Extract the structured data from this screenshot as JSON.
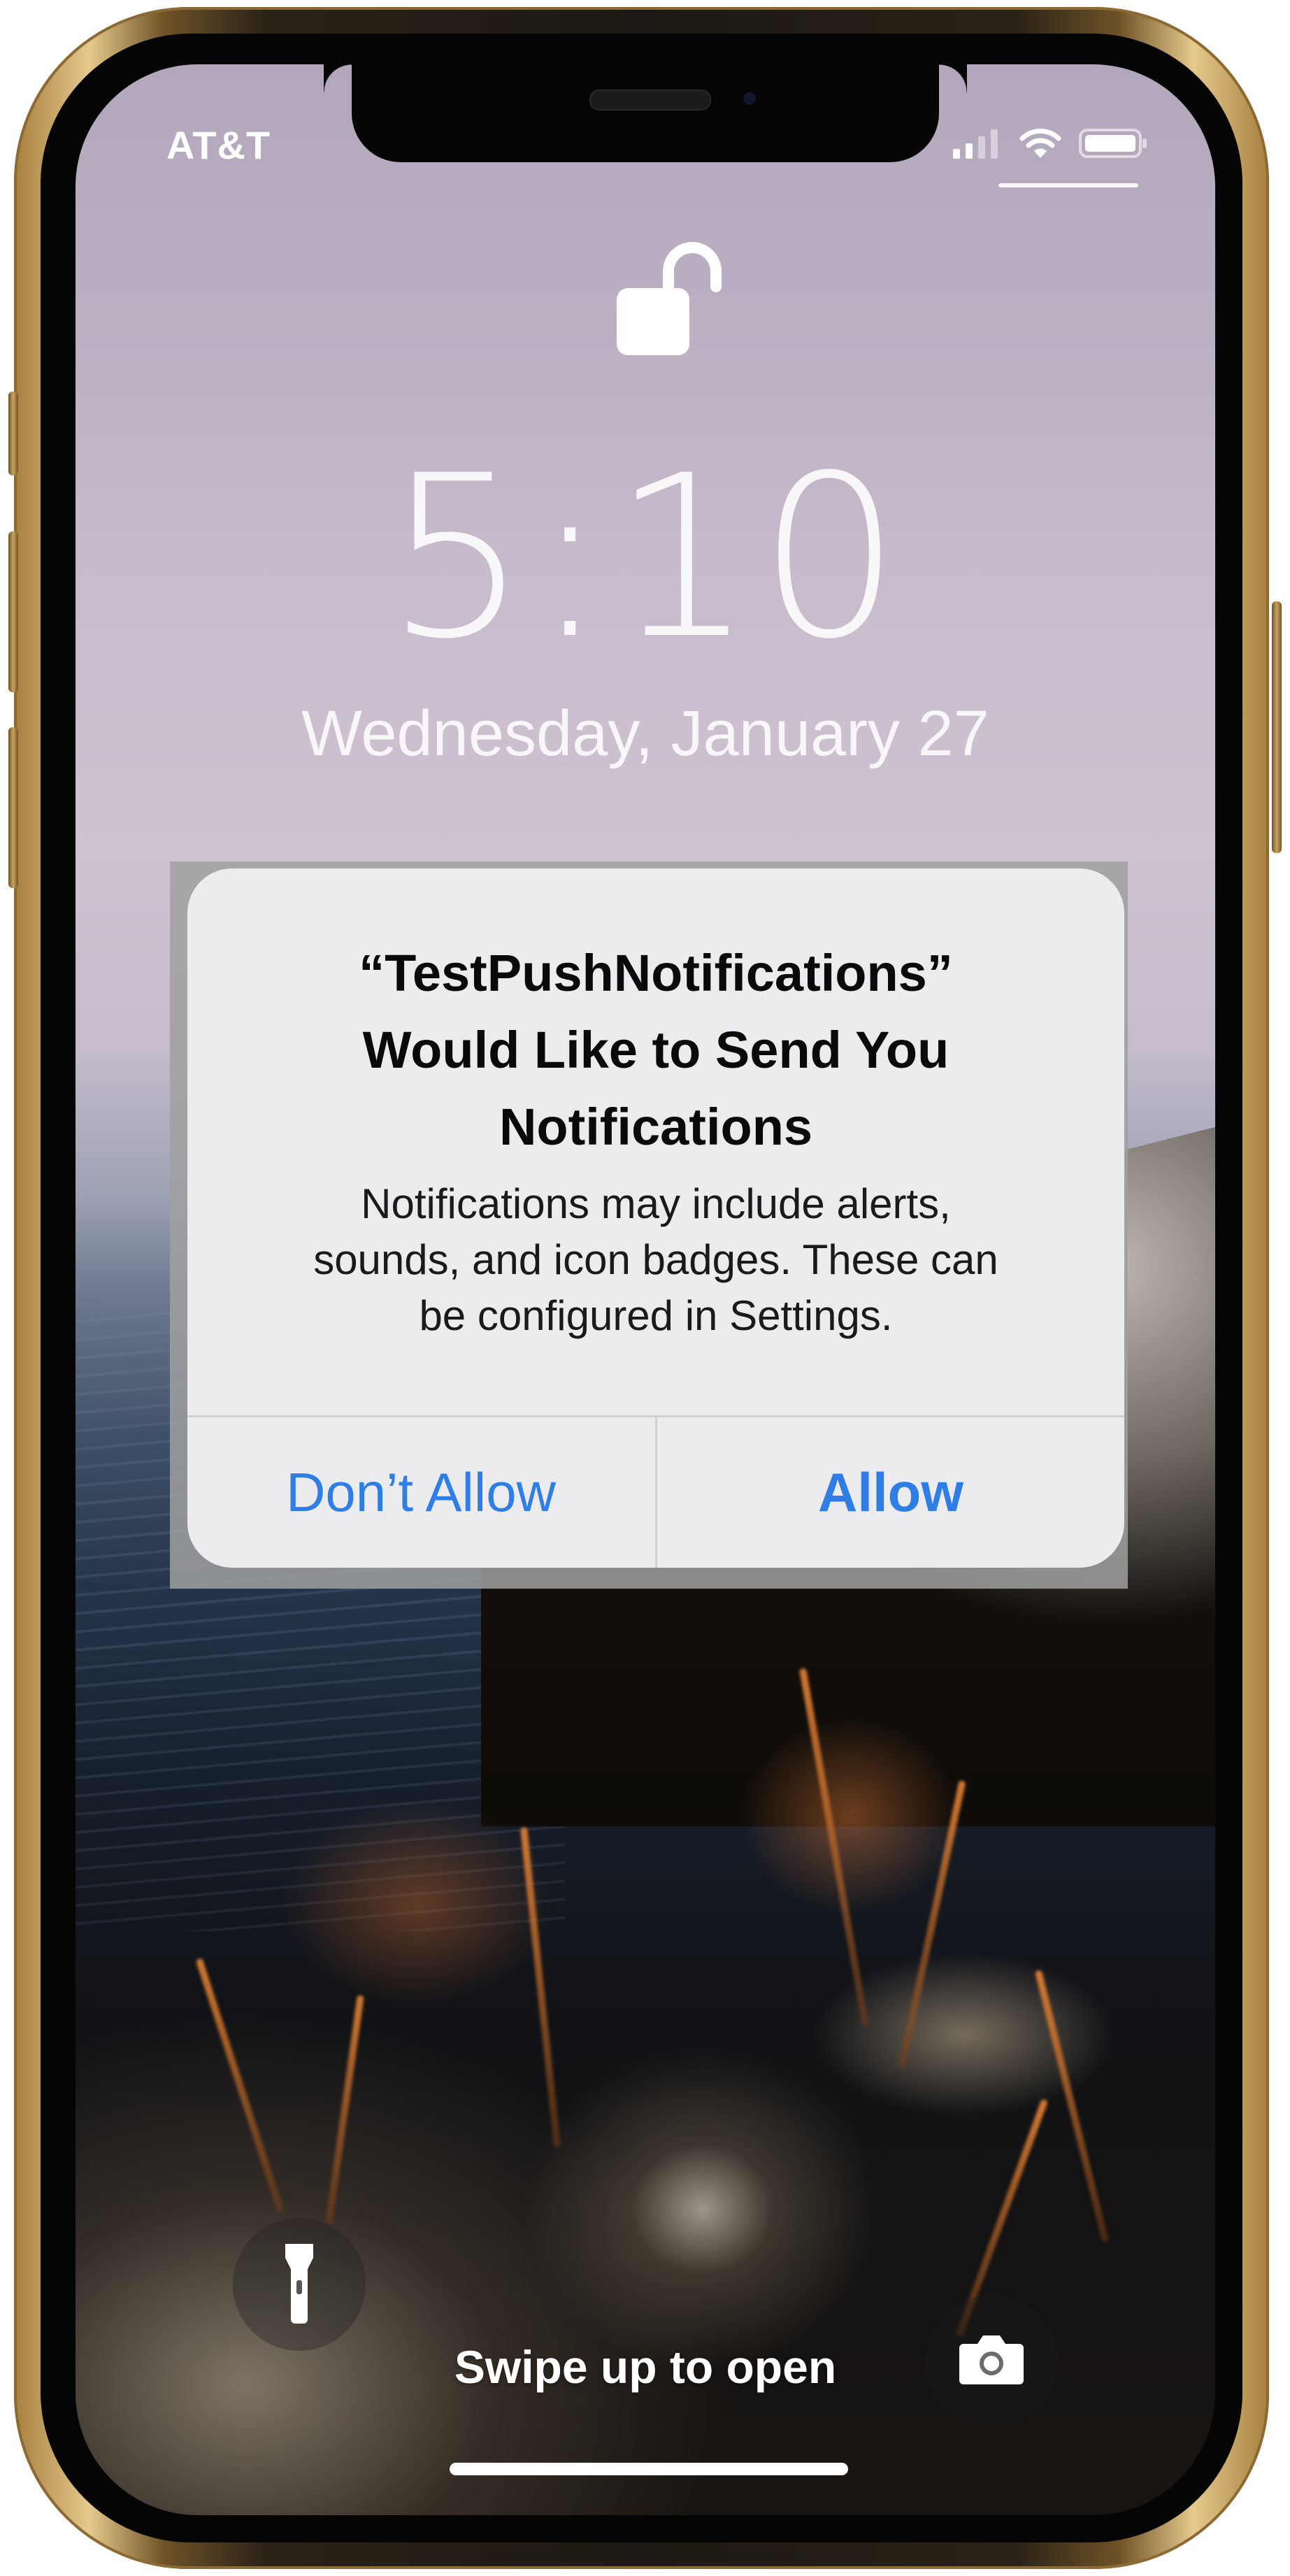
{
  "status_bar": {
    "carrier": "AT&T",
    "icons": [
      "cellular-signal-icon",
      "wifi-icon",
      "battery-icon"
    ]
  },
  "lock_screen": {
    "lock_icon": "unlocked-padlock-icon",
    "time": "5:10",
    "date": "Wednesday, January 27",
    "swipe_hint": "Swipe up to open",
    "left_control_icon": "flashlight-icon",
    "right_control_icon": "camera-icon"
  },
  "alert": {
    "title_line1": "“TestPushNotifications”",
    "title_line2": "Would Like to Send You",
    "title_line3": "Notifications",
    "message_line1": "Notifications may include alerts,",
    "message_line2": "sounds, and icon badges. These can",
    "message_line3": "be configured in Settings.",
    "deny_label": "Don’t Allow",
    "allow_label": "Allow"
  },
  "colors": {
    "alert_button_text": "#2f7ee6",
    "alert_background": "#ececee",
    "phone_frame": "#c9a25e"
  }
}
